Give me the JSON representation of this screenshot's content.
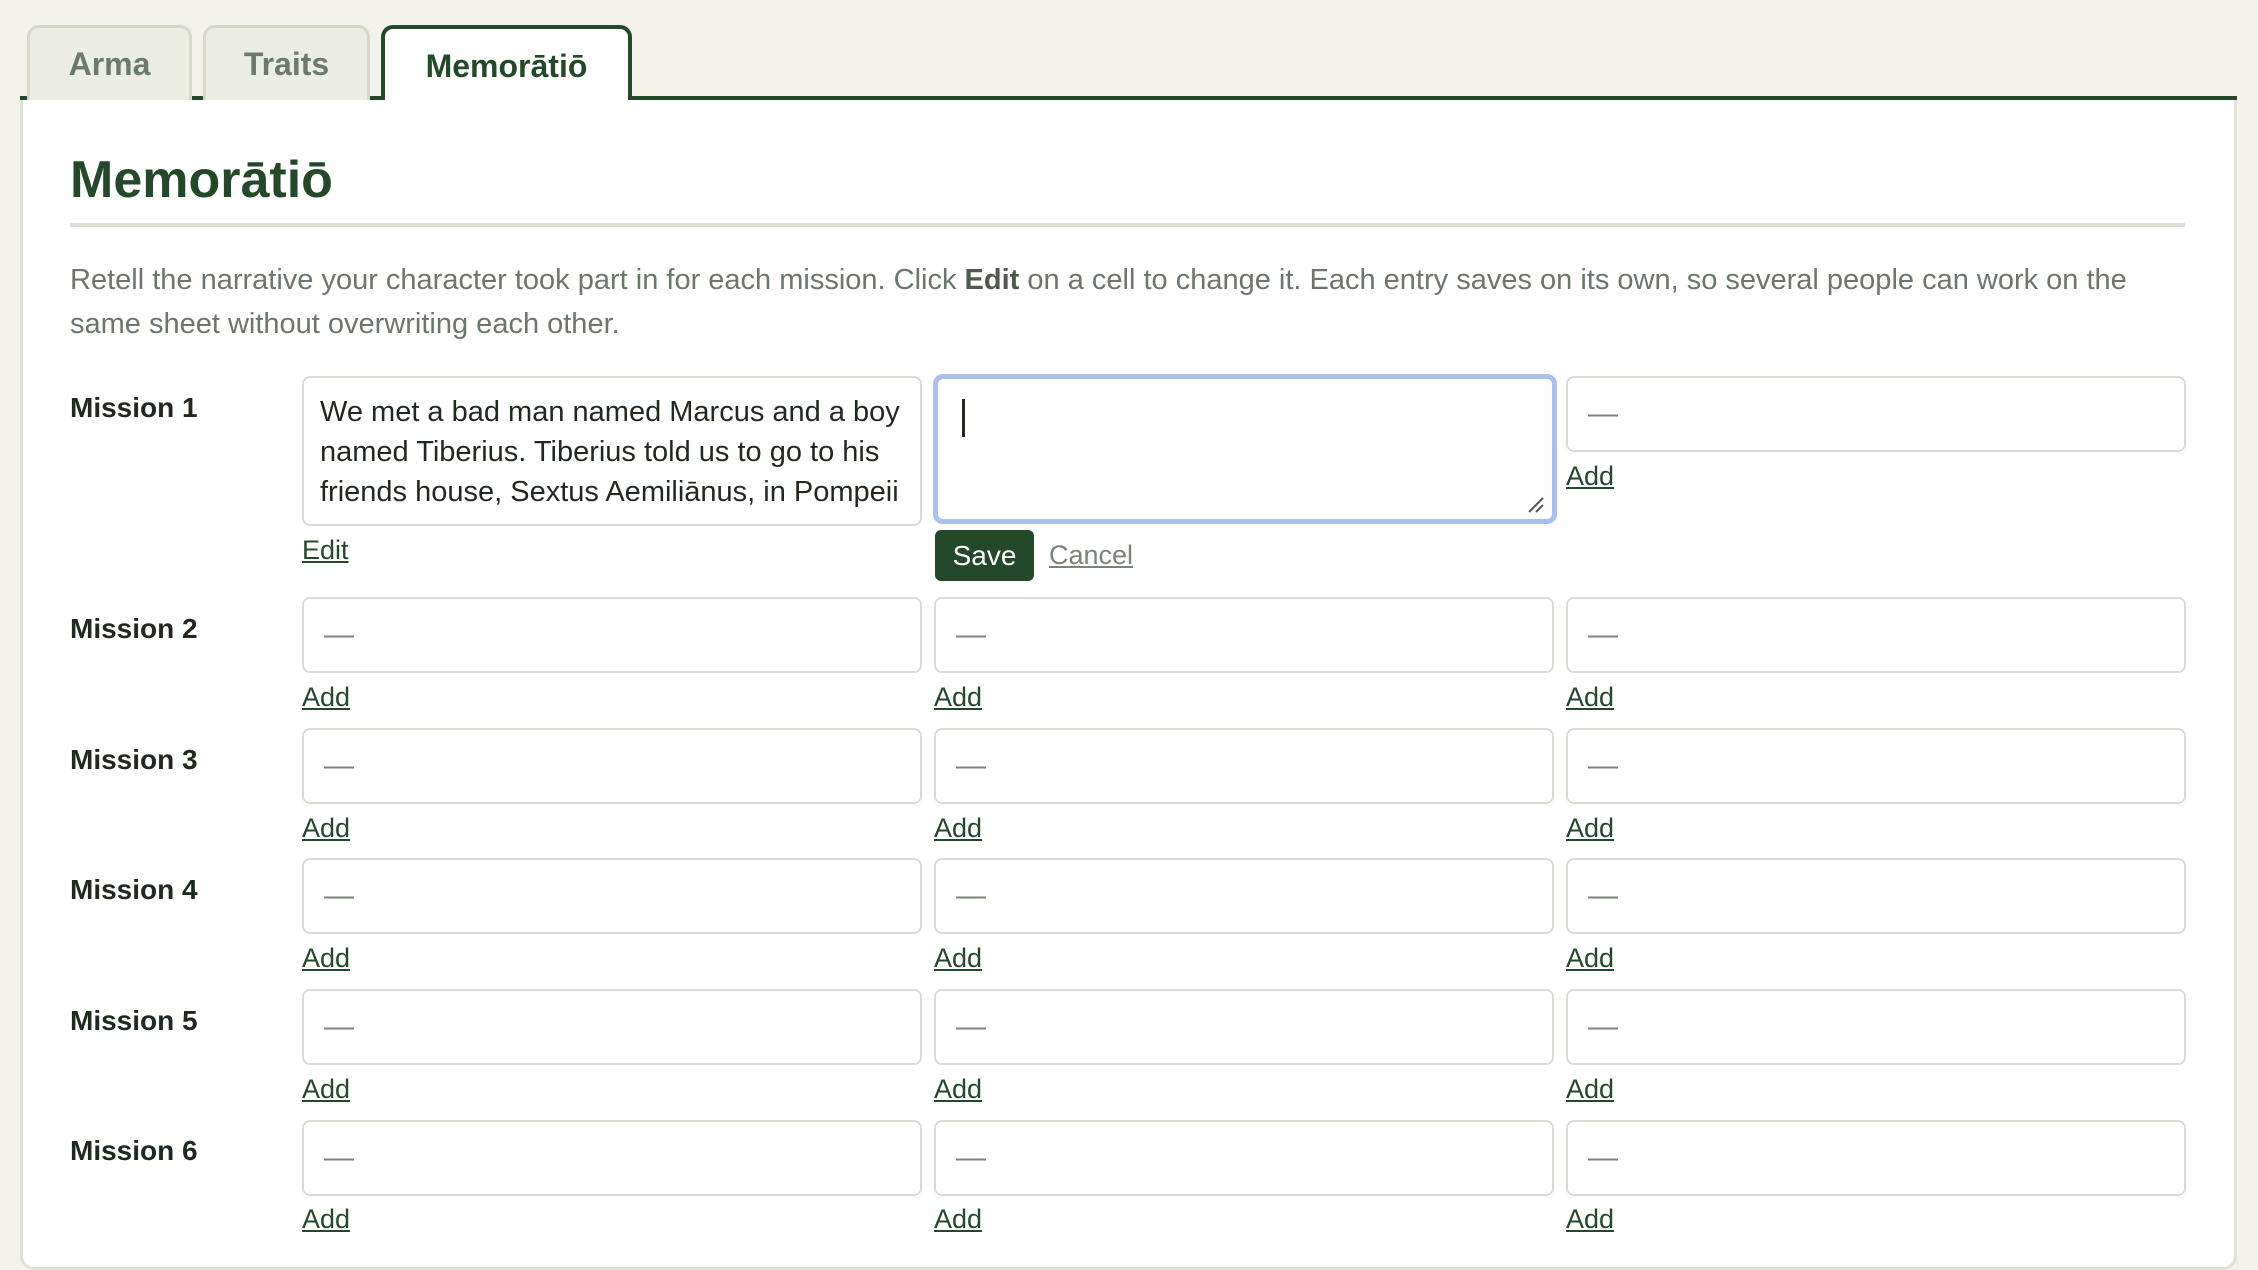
{
  "tabs": [
    "Arma",
    "Traits",
    "Memorātiō"
  ],
  "page_title": "Memorātiō",
  "intro": {
    "before": "Retell the narrative your character took part in for each mission. Click ",
    "bold": "Edit",
    "after": " on a cell to change it. Each entry saves on its own, so several people can work on the same sheet without overwriting each other."
  },
  "missions": [
    "Mission 1",
    "Mission 2",
    "Mission 3",
    "Mission 4",
    "Mission 5",
    "Mission 6"
  ],
  "mission1_entry": "We met a bad man named Marcus and a boy named Tiberius. Tiberius told us to go to his friends house, Sextus Aemiliānus, in Pompeii",
  "empty_value": "—",
  "editor_value": "",
  "labels": {
    "edit": "Edit",
    "add": "Add",
    "save": "Save",
    "cancel": "Cancel"
  }
}
